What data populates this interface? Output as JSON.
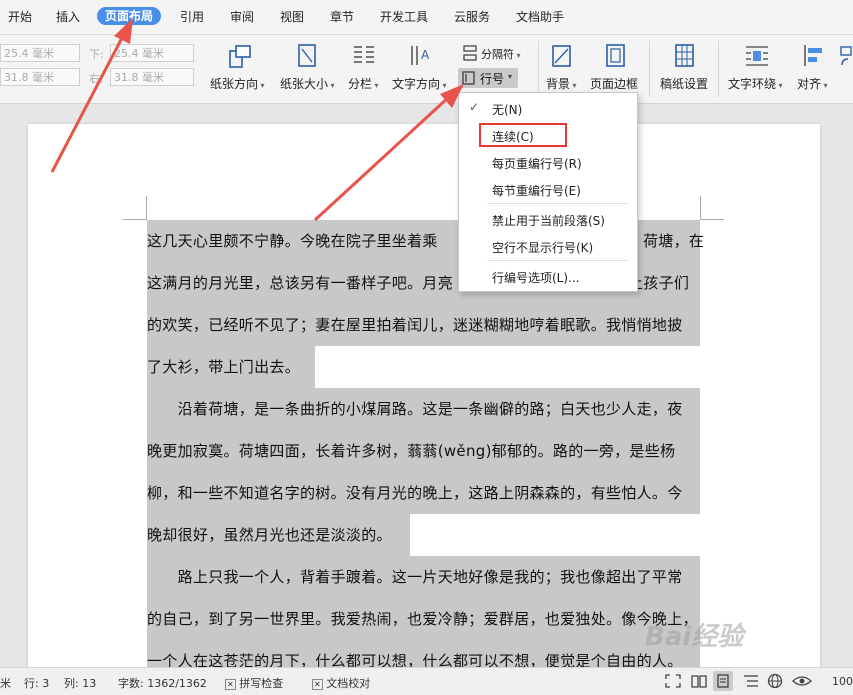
{
  "menu": {
    "items": [
      "开始",
      "插入",
      "页面布局",
      "引用",
      "审阅",
      "视图",
      "章节",
      "开发工具",
      "云服务",
      "文档助手"
    ],
    "active": "页面布局"
  },
  "ribbon": {
    "margin_top": "25.4 毫米",
    "margin_bottom_label": "下:",
    "margin_bottom": "25.4 毫米",
    "margin_left": "31.8 毫米",
    "margin_right_label": "右:",
    "margin_right": "31.8 毫米",
    "orientation": "纸张方向",
    "size": "纸张大小",
    "columns": "分栏",
    "text_direction": "文字方向",
    "separator": "分隔符",
    "line_number": "行号",
    "background": "背景",
    "page_border": "页面边框",
    "manuscript": "稿纸设置",
    "wrap": "文字环绕",
    "align": "对齐"
  },
  "dropdown": {
    "items": [
      "无(N)",
      "连续(C)",
      "每页重编行号(R)",
      "每节重编行号(E)",
      "禁止用于当前段落(S)",
      "空行不显示行号(K)",
      "行编号选项(L)..."
    ],
    "checked": "无(N)",
    "checkmark": "✓"
  },
  "document": {
    "lines": [
      " 这几天心里颇不宁静。今晚在院子里坐着乘",
      "荷塘，在",
      "这满月的月光里，总该另有一番样子吧。月亮",
      "上孩子们",
      "的欢笑，已经听不见了；妻在屋里拍着闰儿，迷迷糊糊地哼着眠歌。我悄悄地披",
      "了大衫，带上门出去。",
      "　　沿着荷塘，是一条曲折的小煤屑路。这是一条幽僻的路；白天也少人走，夜",
      "晚更加寂寞。荷塘四面，长着许多树，蓊蓊(wěng)郁郁的。路的一旁，是些杨",
      "柳，和一些不知道名字的树。没有月光的晚上，这路上阴森森的，有些怕人。今",
      "晚却很好，虽然月光也还是淡淡的。",
      "　　路上只我一个人，背着手踱着。这一片天地好像是我的；我也像超出了平常",
      "的自己，到了另一世界里。我爱热闹，也爱冷静；爱群居，也爱独处。像今晚上，",
      "一个人在这苍茫的月下，什么都可以想，什么都可以不想，便觉是个自由的人。"
    ]
  },
  "status": {
    "page_frag": "米",
    "row": "行: 3",
    "col": "列: 13",
    "words": "字数: 1362/1362",
    "spell": "拼写检查",
    "proof": "文档校对",
    "zoom": "100"
  },
  "watermark": "Bai经验",
  "colors": {
    "accent": "#4a8fe7",
    "arrow": "#e8534a",
    "highlight": "#e53935",
    "selection": "#c8c8c8"
  }
}
